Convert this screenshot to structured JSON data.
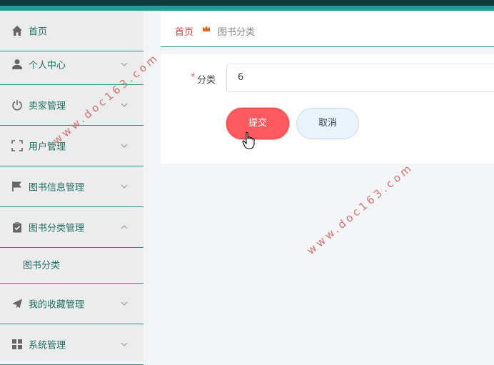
{
  "sidebar": {
    "items": [
      {
        "label": "首页",
        "icon": "home-icon",
        "expandable": false
      },
      {
        "label": "个人中心",
        "icon": "user-icon",
        "expandable": true
      },
      {
        "label": "卖家管理",
        "icon": "power-icon",
        "expandable": true
      },
      {
        "label": "用户管理",
        "icon": "frame-icon",
        "expandable": true
      },
      {
        "label": "图书信息管理",
        "icon": "flag-icon",
        "expandable": true
      },
      {
        "label": "图书分类管理",
        "icon": "clipboard-icon",
        "expandable": true,
        "expanded": true,
        "children": [
          {
            "label": "图书分类"
          }
        ]
      },
      {
        "label": "我的收藏管理",
        "icon": "send-icon",
        "expandable": true
      },
      {
        "label": "系统管理",
        "icon": "grid-icon",
        "expandable": true
      }
    ]
  },
  "breadcrumb": {
    "home": "首页",
    "current": "图书分类"
  },
  "form": {
    "required_mark": "*",
    "category_label": "分类",
    "category_value": "6",
    "submit_label": "提交",
    "cancel_label": "取消"
  },
  "watermark": {
    "text": "www.doc163.com"
  },
  "colors": {
    "accent": "#1e9c96",
    "submit": "#ff5a5f",
    "menu_text": "#1e6f63"
  }
}
